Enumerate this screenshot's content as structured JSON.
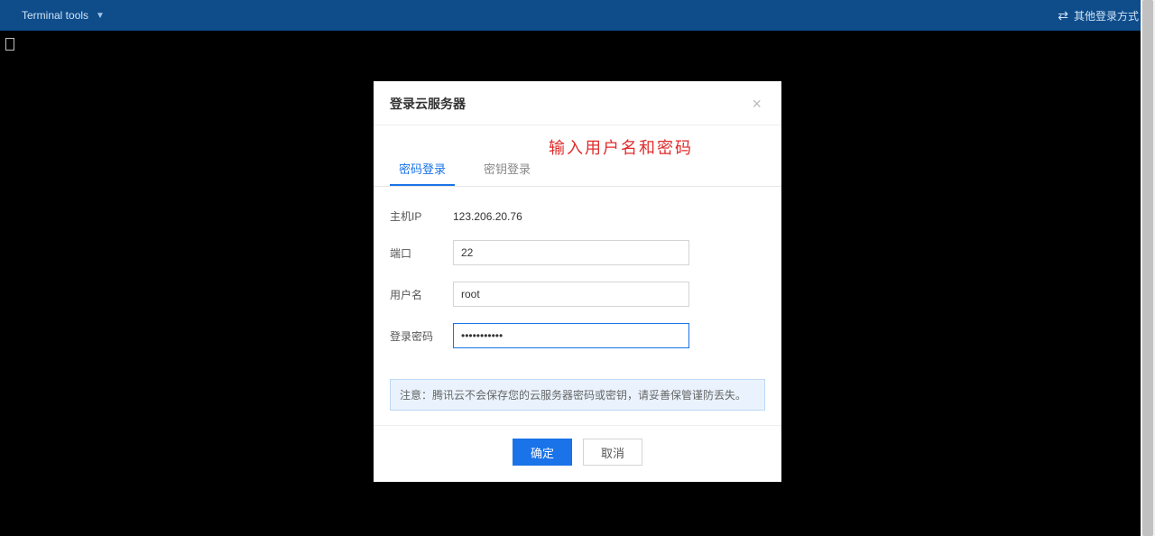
{
  "topbar": {
    "menu_label": "Terminal tools",
    "other_login_label": "其他登录方式"
  },
  "annotation": "输入用户名和密码",
  "modal": {
    "title": "登录云服务器",
    "tabs": {
      "password": "密码登录",
      "key": "密钥登录"
    },
    "form": {
      "host_ip_label": "主机IP",
      "host_ip_value": "123.206.20.76",
      "port_label": "端口",
      "port_value": "22",
      "username_label": "用户名",
      "username_value": "root",
      "password_label": "登录密码",
      "password_value": "•••••••••••"
    },
    "notice": "注意：腾讯云不会保存您的云服务器密码或密钥，请妥善保管谨防丢失。",
    "buttons": {
      "ok": "确定",
      "cancel": "取消"
    }
  }
}
